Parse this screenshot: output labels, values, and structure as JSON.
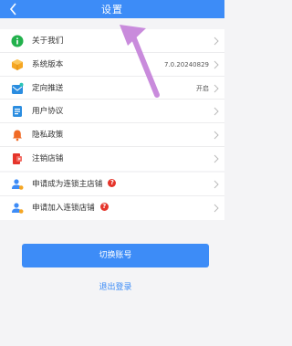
{
  "header": {
    "title": "设置"
  },
  "group1": [
    {
      "label": "关于我们",
      "value": "",
      "icon": "info-icon",
      "color": "#22b14c"
    },
    {
      "label": "系统版本",
      "value": "7.0.20240829",
      "icon": "cube-icon",
      "color": "#f5a623"
    },
    {
      "label": "定向推送",
      "value": "开启",
      "icon": "push-icon",
      "color": "#2b8de0"
    },
    {
      "label": "用户协议",
      "value": "",
      "icon": "document-icon",
      "color": "#2b8de0"
    },
    {
      "label": "隐私政策",
      "value": "",
      "icon": "bell-icon",
      "color": "#f06a25"
    },
    {
      "label": "注销店铺",
      "value": "",
      "icon": "shop-cancel-icon",
      "color": "#e5352b"
    }
  ],
  "group2": [
    {
      "label": "申请成为连锁主店铺",
      "badge": "?",
      "icon": "user-group-icon",
      "color": "#3d8cf7"
    },
    {
      "label": "申请加入连锁店铺",
      "badge": "?",
      "icon": "user-group-icon",
      "color": "#3d8cf7"
    }
  ],
  "buttons": {
    "switch": "切换账号",
    "logout": "退出登录"
  },
  "colors": {
    "accent": "#3d8cf7",
    "annotation_arrow": "#c98bdc"
  }
}
